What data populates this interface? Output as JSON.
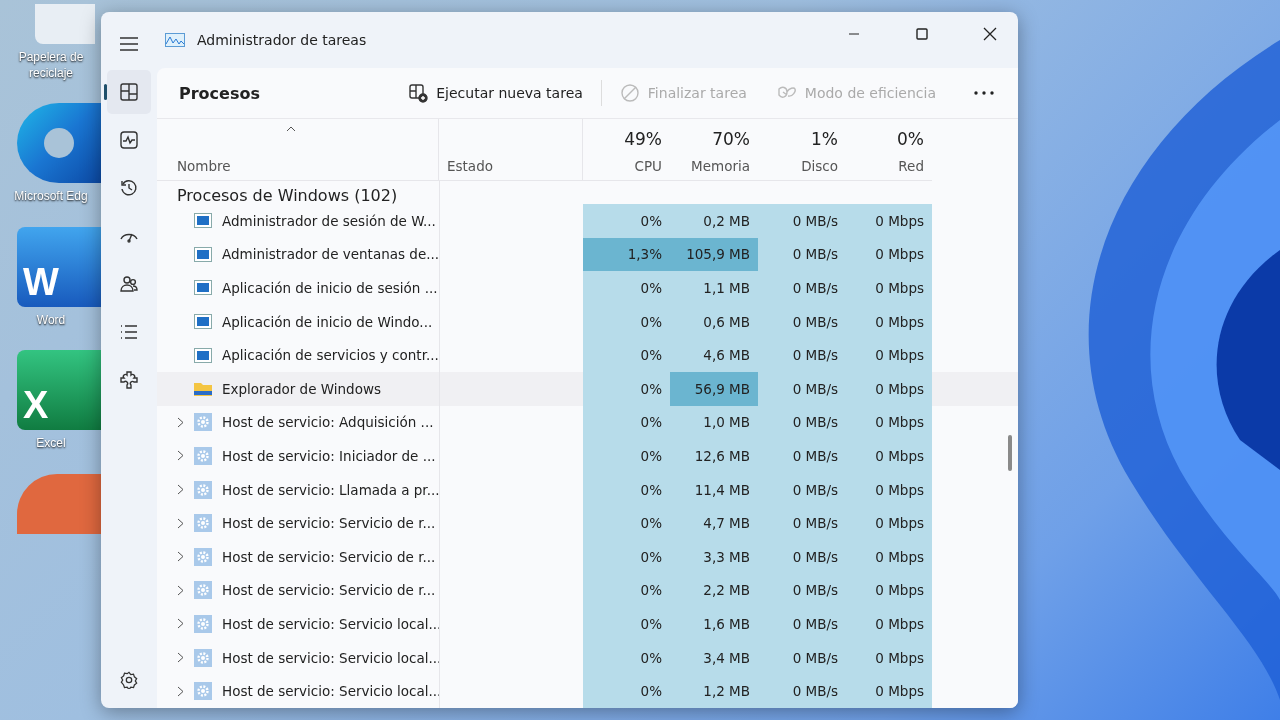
{
  "desktop": {
    "icons": [
      {
        "kind": "bin",
        "label": "Papelera de reciclaje"
      },
      {
        "kind": "edge",
        "label": "Microsoft Edg"
      },
      {
        "kind": "word",
        "letter": "W",
        "label": "Word"
      },
      {
        "kind": "excel",
        "letter": "X",
        "label": "Excel"
      },
      {
        "kind": "ppt"
      }
    ]
  },
  "window": {
    "title": "Administrador de tareas"
  },
  "sidebar": {
    "items": [
      {
        "kind": "processes",
        "selected": true
      },
      {
        "kind": "performance",
        "selected": false
      },
      {
        "kind": "history",
        "selected": false
      },
      {
        "kind": "startup",
        "selected": false
      },
      {
        "kind": "users",
        "selected": false
      },
      {
        "kind": "details",
        "selected": false
      },
      {
        "kind": "services",
        "selected": false
      }
    ]
  },
  "page_title": "Procesos",
  "toolbar": [
    {
      "kind": "run",
      "label": "Ejecutar nueva tarea",
      "disabled": false
    },
    {
      "kind": "end",
      "label": "Finalizar tarea",
      "disabled": true
    },
    {
      "kind": "eco",
      "label": "Modo de eficiencia",
      "disabled": true
    }
  ],
  "table": {
    "columns": [
      {
        "name": "Nombre"
      },
      {
        "name": "Estado"
      },
      {
        "name": "CPU",
        "total": "49%"
      },
      {
        "name": "Memoria",
        "total": "70%"
      },
      {
        "name": "Disco",
        "total": "1%"
      },
      {
        "name": "Red",
        "total": "0%"
      }
    ],
    "group": "Procesos de Windows (102)",
    "rows": [
      {
        "kind": "window",
        "expandable": false,
        "hovered": false,
        "cells": [
          {
            "text": "Administrador de sesión de W..."
          },
          {
            "text": ""
          },
          {
            "text": "0%",
            "hot": false
          },
          {
            "text": "0,2 MB",
            "hot": false
          },
          {
            "text": "0 MB/s",
            "hot": false
          },
          {
            "text": "0 Mbps",
            "hot": false
          }
        ]
      },
      {
        "kind": "window",
        "expandable": false,
        "hovered": false,
        "cells": [
          {
            "text": "Administrador de ventanas de..."
          },
          {
            "text": ""
          },
          {
            "text": "1,3%",
            "hot": true
          },
          {
            "text": "105,9 MB",
            "hot": true
          },
          {
            "text": "0 MB/s",
            "hot": false
          },
          {
            "text": "0 Mbps",
            "hot": false
          }
        ]
      },
      {
        "kind": "window",
        "expandable": false,
        "hovered": false,
        "cells": [
          {
            "text": "Aplicación de inicio de sesión ..."
          },
          {
            "text": ""
          },
          {
            "text": "0%",
            "hot": false
          },
          {
            "text": "1,1 MB",
            "hot": false
          },
          {
            "text": "0 MB/s",
            "hot": false
          },
          {
            "text": "0 Mbps",
            "hot": false
          }
        ]
      },
      {
        "kind": "window",
        "expandable": false,
        "hovered": false,
        "cells": [
          {
            "text": "Aplicación de inicio de Windo..."
          },
          {
            "text": ""
          },
          {
            "text": "0%",
            "hot": false
          },
          {
            "text": "0,6 MB",
            "hot": false
          },
          {
            "text": "0 MB/s",
            "hot": false
          },
          {
            "text": "0 Mbps",
            "hot": false
          }
        ]
      },
      {
        "kind": "window",
        "expandable": false,
        "hovered": false,
        "cells": [
          {
            "text": "Aplicación de servicios y contr..."
          },
          {
            "text": ""
          },
          {
            "text": "0%",
            "hot": false
          },
          {
            "text": "4,6 MB",
            "hot": false
          },
          {
            "text": "0 MB/s",
            "hot": false
          },
          {
            "text": "0 Mbps",
            "hot": false
          }
        ]
      },
      {
        "kind": "folder",
        "expandable": false,
        "hovered": true,
        "cells": [
          {
            "text": "Explorador de Windows"
          },
          {
            "text": ""
          },
          {
            "text": "0%",
            "hot": false
          },
          {
            "text": "56,9 MB",
            "hot": true
          },
          {
            "text": "0 MB/s",
            "hot": false
          },
          {
            "text": "0 Mbps",
            "hot": false
          }
        ]
      },
      {
        "kind": "service",
        "expandable": true,
        "hovered": false,
        "cells": [
          {
            "text": "Host de servicio: Adquisición ..."
          },
          {
            "text": ""
          },
          {
            "text": "0%",
            "hot": false
          },
          {
            "text": "1,0 MB",
            "hot": false
          },
          {
            "text": "0 MB/s",
            "hot": false
          },
          {
            "text": "0 Mbps",
            "hot": false
          }
        ]
      },
      {
        "kind": "service",
        "expandable": true,
        "hovered": false,
        "cells": [
          {
            "text": "Host de servicio: Iniciador de ..."
          },
          {
            "text": ""
          },
          {
            "text": "0%",
            "hot": false
          },
          {
            "text": "12,6 MB",
            "hot": false
          },
          {
            "text": "0 MB/s",
            "hot": false
          },
          {
            "text": "0 Mbps",
            "hot": false
          }
        ]
      },
      {
        "kind": "service",
        "expandable": true,
        "hovered": false,
        "cells": [
          {
            "text": "Host de servicio: Llamada a pr..."
          },
          {
            "text": ""
          },
          {
            "text": "0%",
            "hot": false
          },
          {
            "text": "11,4 MB",
            "hot": false
          },
          {
            "text": "0 MB/s",
            "hot": false
          },
          {
            "text": "0 Mbps",
            "hot": false
          }
        ]
      },
      {
        "kind": "service",
        "expandable": true,
        "hovered": false,
        "cells": [
          {
            "text": "Host de servicio: Servicio de r..."
          },
          {
            "text": ""
          },
          {
            "text": "0%",
            "hot": false
          },
          {
            "text": "4,7 MB",
            "hot": false
          },
          {
            "text": "0 MB/s",
            "hot": false
          },
          {
            "text": "0 Mbps",
            "hot": false
          }
        ]
      },
      {
        "kind": "service",
        "expandable": true,
        "hovered": false,
        "cells": [
          {
            "text": "Host de servicio: Servicio de r..."
          },
          {
            "text": ""
          },
          {
            "text": "0%",
            "hot": false
          },
          {
            "text": "3,3 MB",
            "hot": false
          },
          {
            "text": "0 MB/s",
            "hot": false
          },
          {
            "text": "0 Mbps",
            "hot": false
          }
        ]
      },
      {
        "kind": "service",
        "expandable": true,
        "hovered": false,
        "cells": [
          {
            "text": "Host de servicio: Servicio de r..."
          },
          {
            "text": ""
          },
          {
            "text": "0%",
            "hot": false
          },
          {
            "text": "2,2 MB",
            "hot": false
          },
          {
            "text": "0 MB/s",
            "hot": false
          },
          {
            "text": "0 Mbps",
            "hot": false
          }
        ]
      },
      {
        "kind": "service",
        "expandable": true,
        "hovered": false,
        "cells": [
          {
            "text": "Host de servicio: Servicio local..."
          },
          {
            "text": ""
          },
          {
            "text": "0%",
            "hot": false
          },
          {
            "text": "1,6 MB",
            "hot": false
          },
          {
            "text": "0 MB/s",
            "hot": false
          },
          {
            "text": "0 Mbps",
            "hot": false
          }
        ]
      },
      {
        "kind": "service",
        "expandable": true,
        "hovered": false,
        "cells": [
          {
            "text": "Host de servicio: Servicio local..."
          },
          {
            "text": ""
          },
          {
            "text": "0%",
            "hot": false
          },
          {
            "text": "3,4 MB",
            "hot": false
          },
          {
            "text": "0 MB/s",
            "hot": false
          },
          {
            "text": "0 Mbps",
            "hot": false
          }
        ]
      },
      {
        "kind": "service",
        "expandable": true,
        "hovered": false,
        "cells": [
          {
            "text": "Host de servicio: Servicio local..."
          },
          {
            "text": ""
          },
          {
            "text": "0%",
            "hot": false
          },
          {
            "text": "1,2 MB",
            "hot": false
          },
          {
            "text": "0 MB/s",
            "hot": false
          },
          {
            "text": "0 Mbps",
            "hot": false
          }
        ]
      }
    ]
  }
}
